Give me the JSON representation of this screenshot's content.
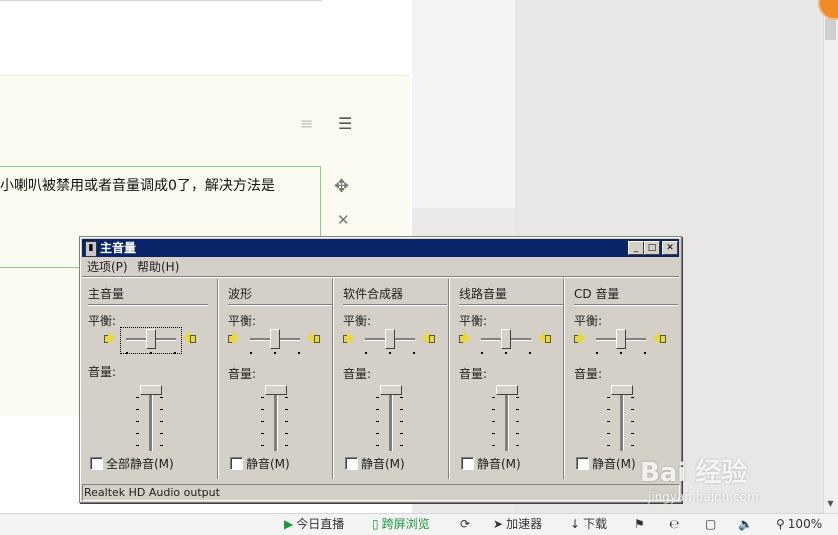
{
  "article": {
    "text": "小喇叭被禁用或者音量调成0了，解决方法是"
  },
  "mixer": {
    "title": "主音量",
    "menu": [
      "选项(P)",
      "帮助(H)"
    ],
    "balance_label": "平衡:",
    "volume_label": "音量:",
    "channels": [
      {
        "name": "主音量",
        "mute_label": "全部静音(M)",
        "balance": 0.5,
        "volume": 1.0
      },
      {
        "name": "波形",
        "mute_label": "静音(M)",
        "balance": 0.5,
        "volume": 1.0
      },
      {
        "name": "软件合成器",
        "mute_label": "静音(M)",
        "balance": 0.5,
        "volume": 1.0
      },
      {
        "name": "线路音量",
        "mute_label": "静音(M)",
        "balance": 0.5,
        "volume": 1.0
      },
      {
        "name": "CD 音量",
        "mute_label": "静音(M)",
        "balance": 0.5,
        "volume": 1.0
      }
    ],
    "device": "Realtek HD Audio output"
  },
  "statusbar": {
    "live": "今日直播",
    "fullscreen": "跨屏浏览",
    "accelerator": "加速器",
    "download": "下载",
    "zoom": "100%"
  },
  "watermark": {
    "brand": "Bai 经验",
    "url": "jingyan.baidu.com"
  },
  "colors": {
    "titlebar": "#0a246a",
    "window_face": "#d4d0c8",
    "accent_green": "#1a9a3a",
    "panel_yellow": "#fbfbf2"
  }
}
